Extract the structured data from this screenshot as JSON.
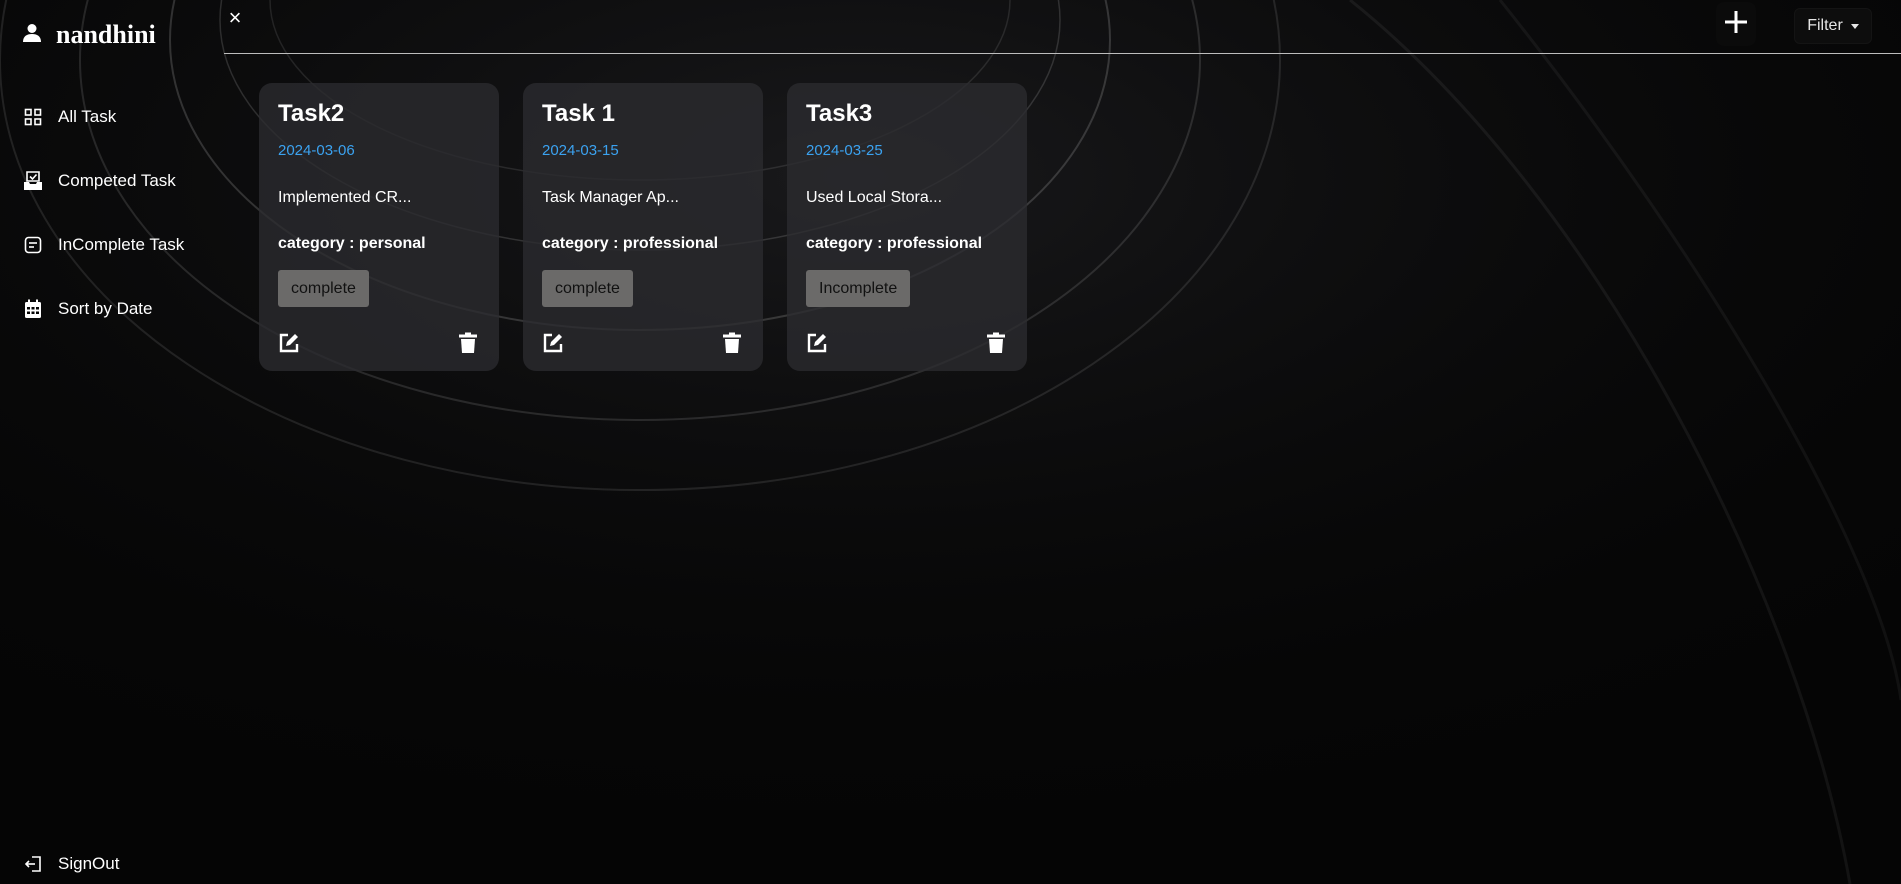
{
  "user": {
    "name": "nandhini",
    "icon": "user-icon"
  },
  "sidebar": {
    "items": [
      {
        "label": "All Task",
        "icon": "grid-icon"
      },
      {
        "label": "Competed Task",
        "icon": "inbox-check-icon"
      },
      {
        "label": "InComplete Task",
        "icon": "note-icon"
      },
      {
        "label": "Sort by Date",
        "icon": "calendar-icon"
      }
    ],
    "signout": {
      "label": "SignOut",
      "icon": "signout-icon"
    }
  },
  "topbar": {
    "close_label": "×",
    "add_icon": "plus-icon",
    "filter_label": "Filter"
  },
  "tasks": [
    {
      "title": "Task2",
      "date": "2024-03-06",
      "description": "Implemented CR...",
      "category": "category : personal",
      "status": "complete"
    },
    {
      "title": "Task 1",
      "date": "2024-03-15",
      "description": "Task Manager Ap...",
      "category": "category : professional",
      "status": "complete"
    },
    {
      "title": "Task3",
      "date": "2024-03-25",
      "description": "Used Local Stora...",
      "category": "category : professional",
      "status": "Incomplete"
    }
  ],
  "colors": {
    "background": "#050505",
    "card": "#2c2c30",
    "date": "#3ba2f0",
    "status_button": "#6b6a69"
  }
}
